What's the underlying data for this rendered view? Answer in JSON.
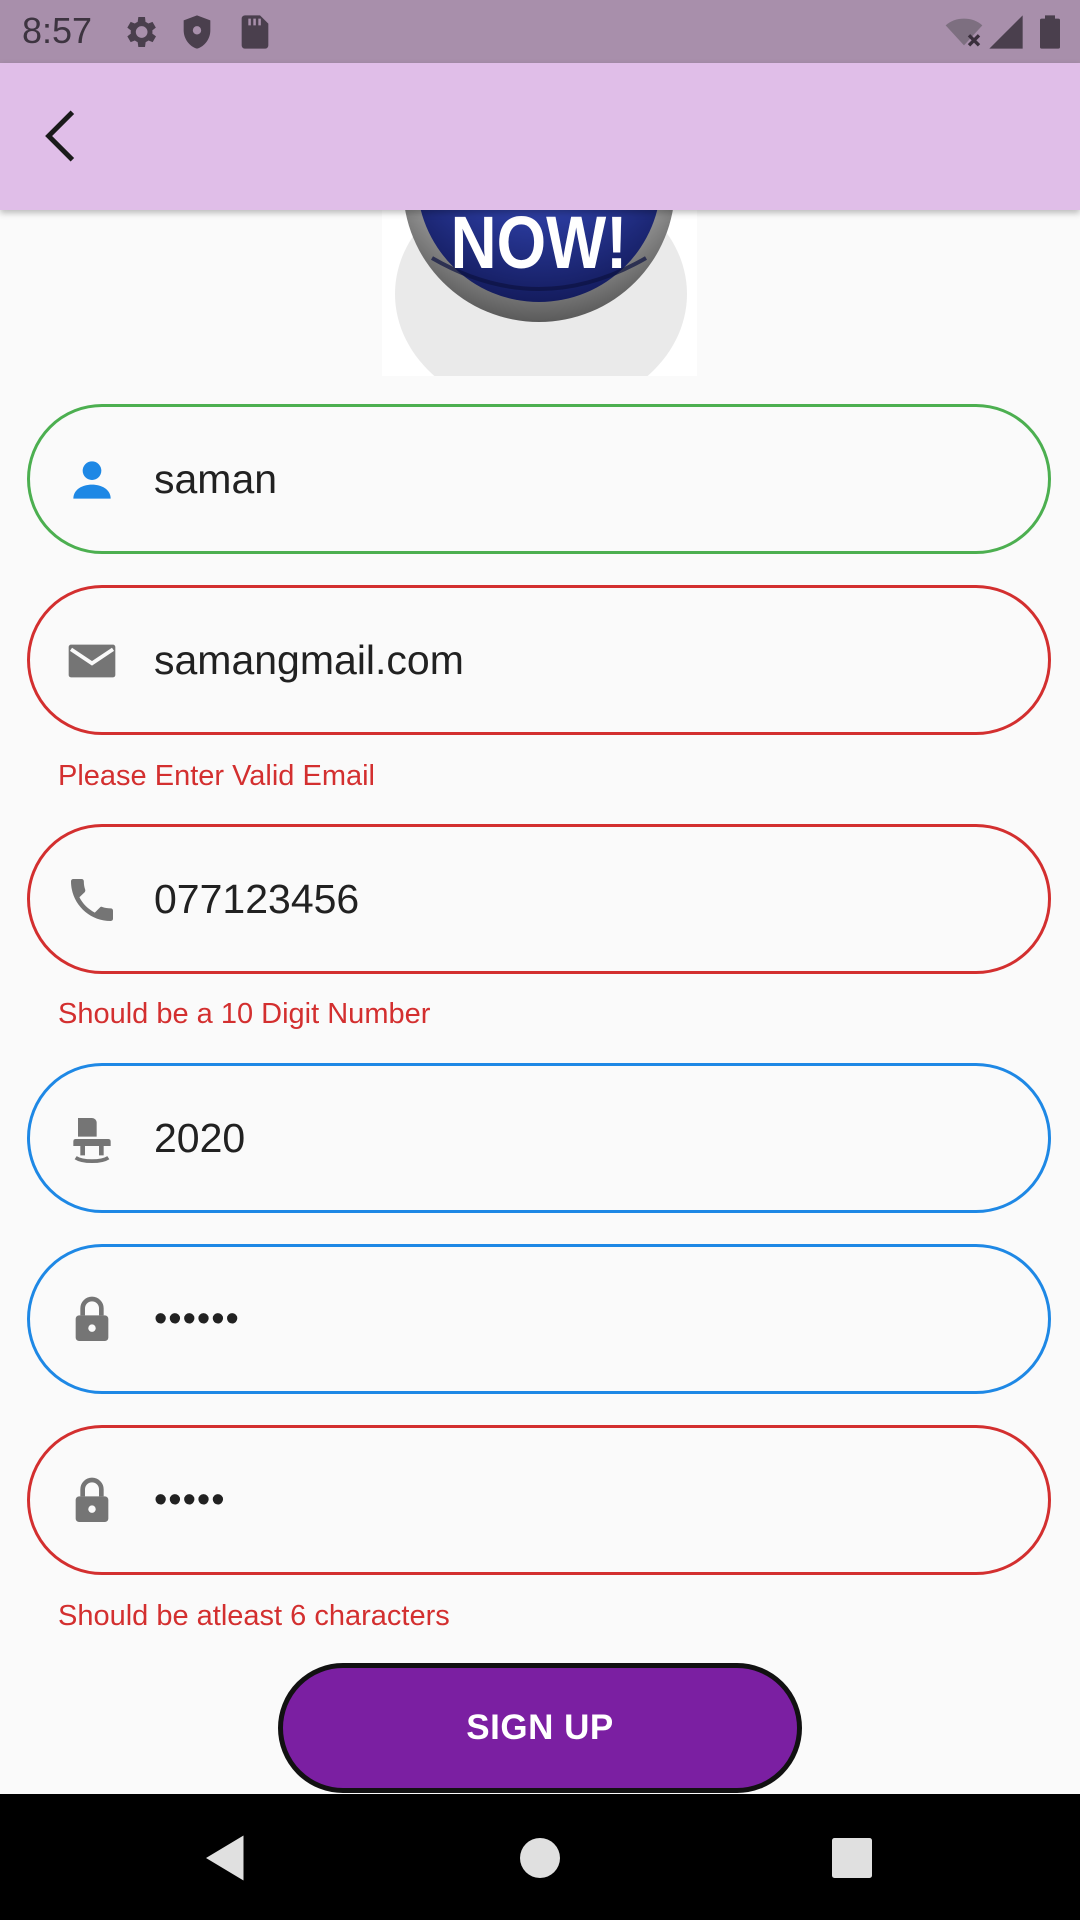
{
  "status_bar": {
    "time": "8:57",
    "icons": [
      "gear-icon",
      "shield-icon",
      "sd-card-icon",
      "wifi-off-icon",
      "signal-icon",
      "battery-icon"
    ]
  },
  "app_bar": {
    "back_icon": "chevron-left-icon"
  },
  "logo": {
    "text": "NOW!"
  },
  "form": {
    "name": {
      "value": "saman",
      "icon": "person-icon"
    },
    "email": {
      "value": "samangmail.com",
      "icon": "mail-icon",
      "error": "Please Enter Valid Email"
    },
    "phone": {
      "value": "077123456",
      "icon": "phone-icon",
      "error": "Should be a 10 Digit Number"
    },
    "year": {
      "value": "2020",
      "icon": "chair-icon"
    },
    "password": {
      "value": "••••••",
      "icon": "lock-icon"
    },
    "confirm_password": {
      "value": "•••••",
      "icon": "lock-icon",
      "error": "Should be atleast 6 characters"
    },
    "submit_label": "SIGN UP"
  },
  "nav_bar": {
    "icons": [
      "back-triangle-icon",
      "home-circle-icon",
      "recents-square-icon"
    ]
  },
  "colors": {
    "status_bar": "#a88fab",
    "app_bar": "#e0bee8",
    "valid_border": "#4caf50",
    "error": "#d32f2f",
    "focus_border": "#1e88e5",
    "button": "#7b1fa2"
  }
}
